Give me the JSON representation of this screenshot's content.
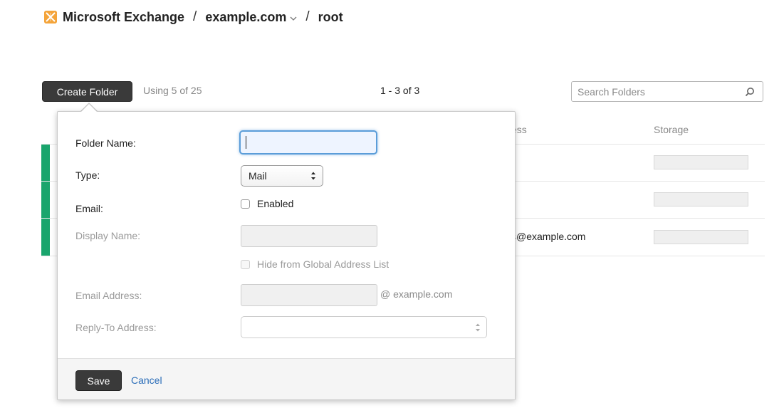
{
  "header": {
    "app_name": "Microsoft Exchange",
    "domain": "example.com",
    "folder": "root",
    "separator": "/",
    "logo_icon": "exchange-logo-icon"
  },
  "toolbar": {
    "create_label": "Create Folder",
    "usage_text": "Using 5 of 25",
    "page_range": "1 - 3 of 3",
    "search_placeholder": "Search Folders"
  },
  "table": {
    "columns": [
      "ess",
      "Storage"
    ],
    "rows": [
      {
        "address": "",
        "status_color": "#1aa56d"
      },
      {
        "address": "",
        "status_color": "#1aa56d"
      },
      {
        "address": "s@example.com",
        "status_color": "#1aa56d"
      }
    ]
  },
  "form": {
    "folder_name_label": "Folder Name:",
    "folder_name_value": "",
    "type_label": "Type:",
    "type_value": "Mail",
    "email_label": "Email:",
    "email_enabled_label": "Enabled",
    "email_enabled": false,
    "display_name_label": "Display Name:",
    "hide_gal_label": "Hide from Global Address List",
    "email_address_label": "Email Address:",
    "email_domain_suffix": "@ example.com",
    "reply_to_label": "Reply-To Address:",
    "reply_to_value": ""
  },
  "footer": {
    "save_label": "Save",
    "cancel_label": "Cancel"
  },
  "colors": {
    "accent_link": "#2a6db8",
    "status_green": "#1aa56d",
    "focus_blue": "#5b9dd9",
    "dark_button": "#3a3a3a"
  }
}
